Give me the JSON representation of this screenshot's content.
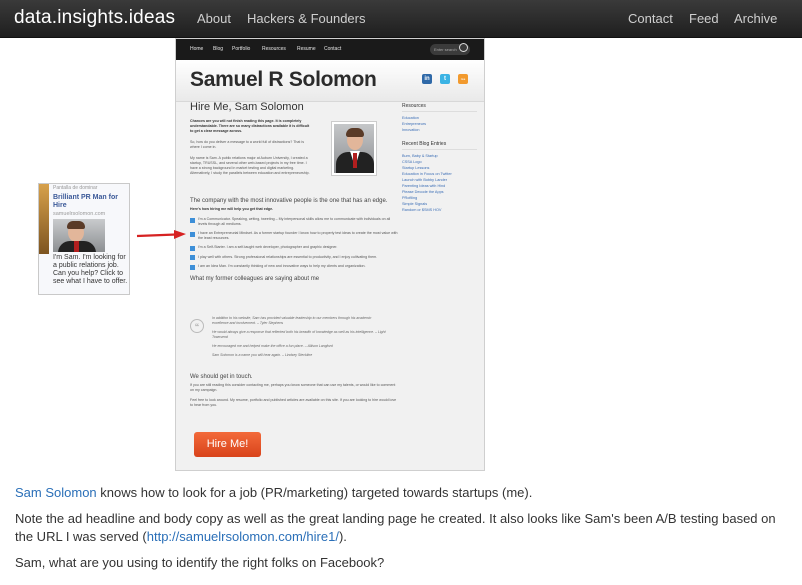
{
  "header": {
    "brand": "data.insights.ideas",
    "left_links": [
      "About",
      "Hackers & Founders"
    ],
    "right_links": [
      "Contact",
      "Feed",
      "Archive"
    ]
  },
  "landing": {
    "nav": [
      "Home",
      "Blog",
      "Portfolio",
      "Resources",
      "Resume",
      "Contact"
    ],
    "search_placeholder": "Enter search",
    "name": "Samuel R Solomon",
    "social": [
      "in",
      "t",
      "rss"
    ],
    "hire_title": "Hire Me, Sam Solomon",
    "intro": [
      "Chances are you will not finish reading this page. It is completely understandable. There are so many distractions available it is difficult to get a clear message across.",
      "So, how do you deliver a message to a world full of distractions? That is where I come in.",
      "My name is Sam. A public relations major at Auburn University, I created a startup, TRUSSL, and several other web-based projects in my free time. I have a strong background in market testing and digital marketing. Alternatively, I study the parallels between education and entrepreneurship."
    ],
    "section_edge": "The company with the most innovative people is the one that has an edge.",
    "help_line": "Here's how hiring me will help you get that edge.",
    "checks": [
      "I'm a Communicator. Speaking, writing, tweeting – My interpersonal skills allow me to communicate with individuals on all levels through all mediums.",
      "I have an Entrepreneurial Mindset. As a former startup founder I know how to properly test ideas to create the most value with the least resources.",
      "I'm a Self-Starter. I am a self-taught web developer, photographer and graphic designer.",
      "I play well with others. Strong professional relationships are essential to productivity, and I enjoy cultivating them.",
      "I am an Idea Man. I'm constantly thinking of new and innovative ways to help my clients and organization."
    ],
    "colleagues_h": "What my former colleagues are saying about me",
    "quotes": [
      "In addition to his website, Sam has provided valuable leadership to our members through his academic excellence and involvement. – Tyler Stephens",
      "He would always give a response that reflected both his breadth of knowledge as well as his intelligence. – Light Townsend",
      "He encouraged me and helped make the office a fun place. – Allison Langford",
      "Sam Solomon is a name you will hear again. – Lindsey Steckline"
    ],
    "touch_h": "We should get in touch.",
    "touch_text": [
      "If you are still reading this consider contacting me, perhaps you know someone that can use my talents, or would like to comment on my campaign.",
      "Feel free to look around. My resume, portfolio and published articles are available on this site. If you are looking to hire would love to hear from you."
    ],
    "hire_button": "Hire Me!",
    "sidebar": {
      "resources_h": "Resources",
      "resources": [
        "Education",
        "Entrepreneurs",
        "Innovation"
      ],
      "recent_h": "Recent Blog Entries",
      "recent": [
        "Burn, Baby & Startup",
        "CSSA Logo",
        "Startup Lessons",
        "Education in Focus on Twitter",
        "Launch with Bobby Lander",
        "Parenting Ideas with Hind",
        "Please Decode the Apps",
        "PRofiling",
        "Simple Signals",
        "Random or $SMS HOV"
      ]
    }
  },
  "ad": {
    "top_text": "Pantalla de dominar",
    "headline": "Brilliant PR Man for Hire",
    "url": "samuelrsolomon.com",
    "body": "I'm Sam. I'm looking for a public relations job. Can you help? Click to see what I have to offer."
  },
  "article": {
    "p1_link": "Sam Solomon",
    "p1_rest": " knows how to look for a job (PR/marketing) targeted towards startups (me).",
    "p2_a": "Note the ad headline and body copy as well as the great landing page he created. It also looks like Sam's been A/B testing based on the URL I was served (",
    "p2_link": "http://samuelrsolomon.com/hire1/",
    "p2_b": ").",
    "p3": "Sam, what are you using to identify the right folks on Facebook?"
  },
  "colors": {
    "link": "#2a6fb8",
    "topbar": "#2a2a2a",
    "cta": "#e2522a",
    "arrow": "#d62222"
  }
}
